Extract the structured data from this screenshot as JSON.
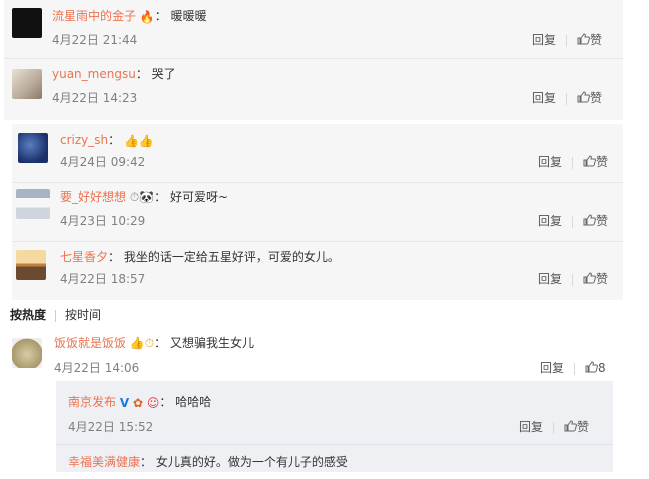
{
  "actions": {
    "reply": "回复",
    "like": "赞"
  },
  "comments_a": [
    {
      "user": "流星雨中的金子",
      "text": "暖暖暖",
      "time": "4月22日 21:44"
    },
    {
      "user": "yuan_mengsu",
      "text": "哭了",
      "time": "4月22日 14:23"
    }
  ],
  "comments_b": [
    {
      "user": "crizy_sh",
      "text": "",
      "time": "4月24日 09:42"
    },
    {
      "user": "要_好好想想",
      "text": "好可爱呀~",
      "time": "4月23日 10:29"
    },
    {
      "user": "七星香夕",
      "text": "我坐的话一定给五星好评，可爱的女儿。",
      "time": "4月22日 18:57"
    }
  ],
  "sort": {
    "hot": "按热度",
    "time": "按时间"
  },
  "hot_comment": {
    "user": "饭饭就是饭饭",
    "text": "又想骗我生女儿",
    "time": "4月22日 14:06",
    "likes": "8"
  },
  "replies": [
    {
      "user": "南京发布",
      "text": "哈哈哈",
      "time": "4月22日 15:52"
    },
    {
      "user": "幸福美满健康",
      "text": "女儿真的好。做为一个有儿子的感受",
      "time": ""
    }
  ],
  "colors": {
    "username": "#eb7350",
    "panel": "#f6f6f6",
    "quote": "#eef0f4",
    "timestamp": "#808080"
  }
}
